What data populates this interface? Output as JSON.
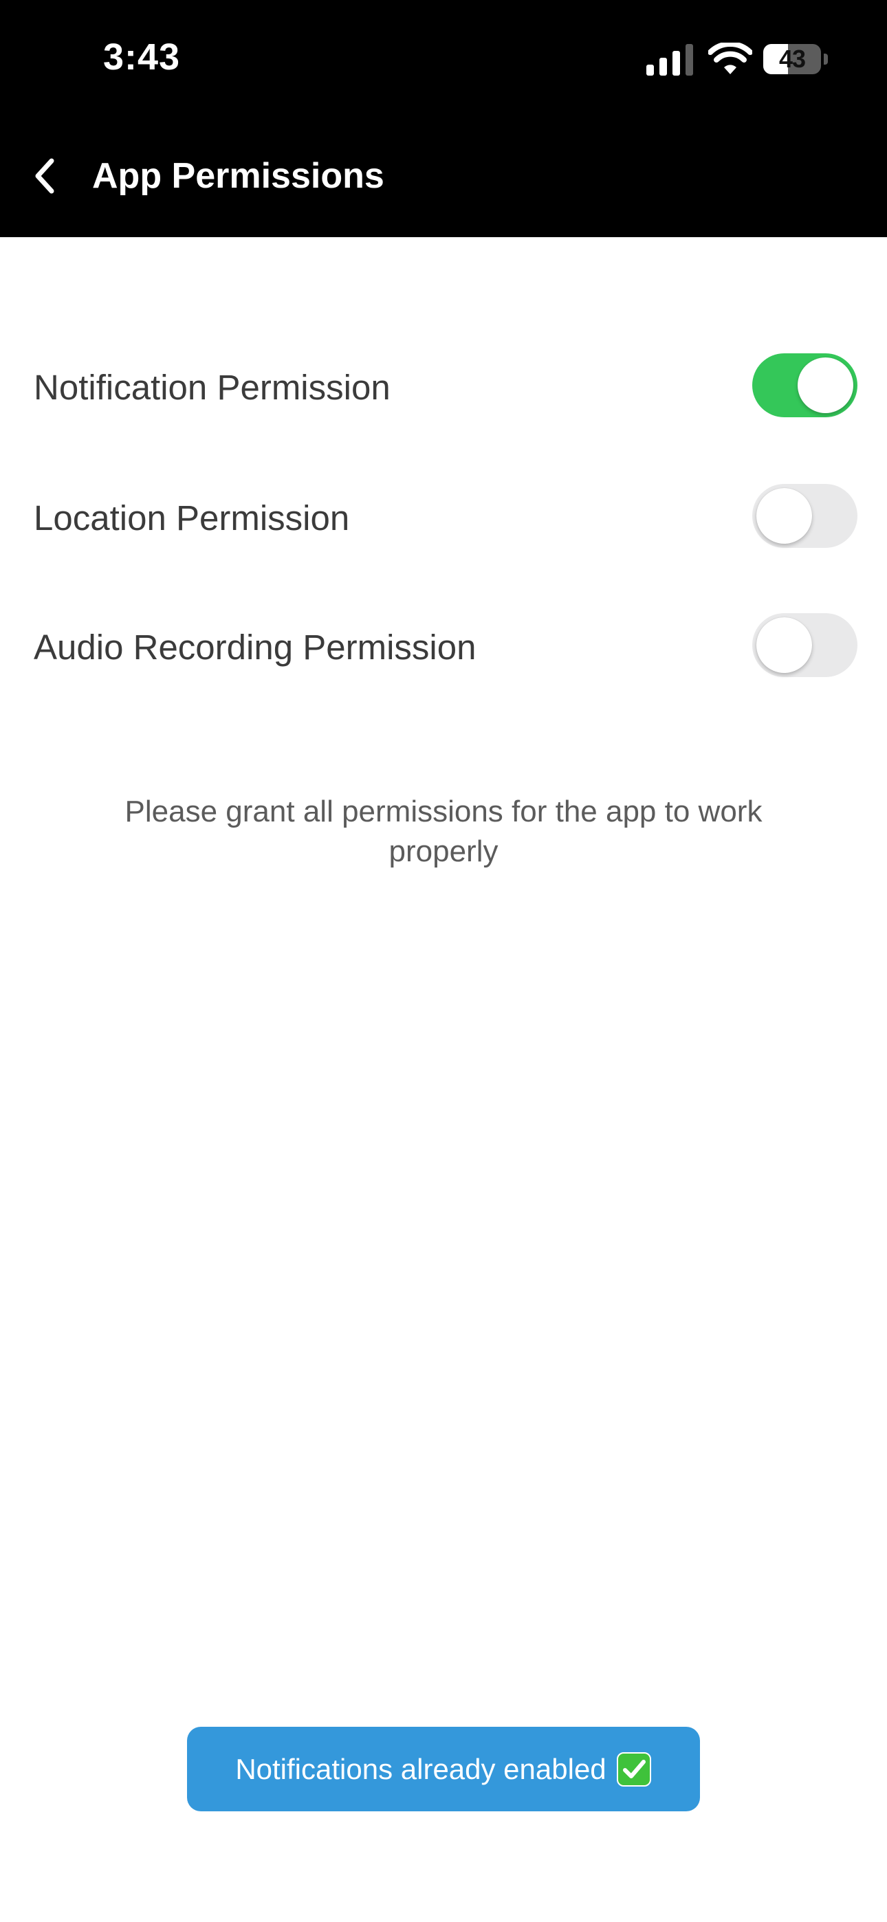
{
  "status_bar": {
    "time": "3:43",
    "battery_percent": "43",
    "battery_level": 0.43,
    "icons": [
      "signal-icon",
      "wifi-icon",
      "battery-icon"
    ]
  },
  "nav": {
    "back_icon": "chevron-left-icon",
    "title": "App Permissions"
  },
  "permissions": [
    {
      "label": "Notification Permission",
      "enabled": true
    },
    {
      "label": "Location Permission",
      "enabled": false
    },
    {
      "label": "Audio Recording Permission",
      "enabled": false
    }
  ],
  "info_text": "Please grant all permissions for the app to work properly",
  "toast": {
    "text": "Notifications already enabled",
    "icon": "check-mark-button-icon"
  },
  "colors": {
    "toggle_on": "#34c759",
    "toggle_off": "#e9e9ea",
    "toast_background": "#3498db",
    "header_background": "#000000"
  }
}
